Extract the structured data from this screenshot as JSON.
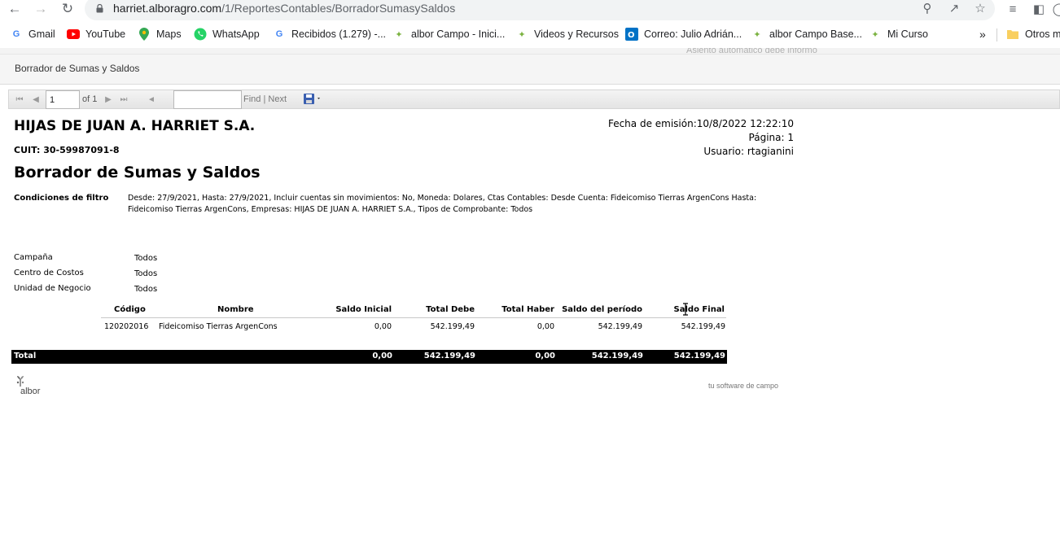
{
  "browser": {
    "url_host": "harriet.alboragro.com",
    "url_path": "/1/ReportesContables/BorradorSumasySaldos",
    "bookmarks": [
      {
        "label": "Gmail",
        "icon": "gmail-icon"
      },
      {
        "label": "YouTube",
        "icon": "youtube-icon"
      },
      {
        "label": "Maps",
        "icon": "maps-icon"
      },
      {
        "label": "WhatsApp",
        "icon": "whatsapp-icon"
      },
      {
        "label": "Recibidos (1.279) -...",
        "icon": "google-icon"
      },
      {
        "label": "albor Campo - Inici...",
        "icon": "albor-icon"
      },
      {
        "label": "Videos y Recursos",
        "icon": "albor-icon"
      },
      {
        "label": "Correo: Julio Adrián...",
        "icon": "outlook-icon"
      },
      {
        "label": "albor Campo Base...",
        "icon": "albor-icon"
      },
      {
        "label": "Mi Curso",
        "icon": "albor-icon"
      }
    ],
    "overflow_label": "»",
    "other_bookmarks": "Otros m"
  },
  "page": {
    "title": "Borrador de Sumas y Saldos",
    "ghost_text": "Asiento automático debe informo"
  },
  "report_toolbar": {
    "page_value": "1",
    "of_label": "of 1",
    "find_label": "Find",
    "separator": "|",
    "next_label": "Next"
  },
  "report": {
    "company": "HIJAS DE JUAN A. HARRIET S.A.",
    "cuit": "CUIT: 30-59987091-8",
    "title": "Borrador de Sumas y Saldos",
    "fecha_emision": "Fecha de emisión:10/8/2022 12:22:10",
    "pagina": "Página: 1",
    "usuario": "Usuario: rtagianini",
    "filtro_label": "Condiciones de filtro",
    "filtro_text": "Desde: 27/9/2021, Hasta: 27/9/2021, Incluir cuentas sin movimientos: No, Moneda: Dolares, Ctas Contables: Desde Cuenta: Fideicomiso Tierras ArgenCons Hasta: Fideicomiso Tierras ArgenCons, Empresas: HIJAS DE JUAN A. HARRIET S.A., Tipos de Comprobante: Todos",
    "campana_label": "Campaña",
    "campana_value": "Todos",
    "centro_label": "Centro de Costos",
    "centro_value": "Todos",
    "unidad_label": "Unidad de Negocio",
    "unidad_value": "Todos",
    "columns": [
      "Código",
      "Nombre",
      "Saldo Inicial",
      "Total Debe",
      "Total Haber",
      "Saldo del período",
      "Saldo Final"
    ],
    "rows": [
      [
        "120202016",
        "Fideicomiso Tierras ArgenCons",
        "0,00",
        "542.199,49",
        "0,00",
        "542.199,49",
        "542.199,49"
      ]
    ],
    "total_label": "Total",
    "totals": [
      "0,00",
      "542.199,49",
      "0,00",
      "542.199,49",
      "542.199,49"
    ],
    "logo_text": "albor",
    "tagline": "tu software de campo"
  }
}
